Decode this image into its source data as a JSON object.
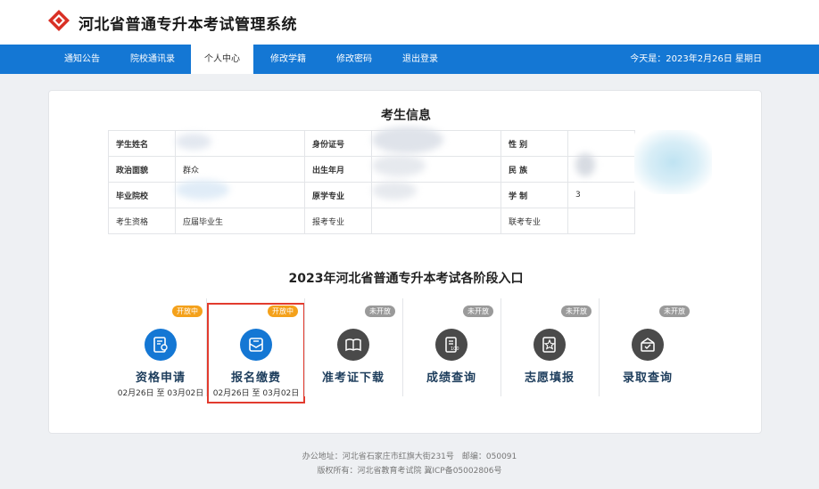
{
  "header": {
    "title": "河北省普通专升本考试管理系统",
    "logo_icon": "diamond-logo-icon"
  },
  "nav": {
    "items": [
      {
        "label": "通知公告"
      },
      {
        "label": "院校通讯录"
      },
      {
        "label": "个人中心",
        "active": true
      },
      {
        "label": "修改学籍"
      },
      {
        "label": "修改密码"
      },
      {
        "label": "退出登录"
      }
    ],
    "date": "今天是：2023年2月26日 星期日"
  },
  "student_info": {
    "title": "考生信息",
    "labels": {
      "name": "学生姓名",
      "id_card": "身份证号",
      "gender": "性 别",
      "politics": "政治面貌",
      "birth": "出生年月",
      "ethnicity": "民 族",
      "school": "毕业院校",
      "major": "原学专业",
      "schooling": "学 制",
      "qualification": "考生资格",
      "apply_major": "报考专业",
      "joint_major": "联考专业"
    },
    "values": {
      "politics": "群众",
      "schooling": "3",
      "qualification": "应届毕业生"
    }
  },
  "stages": {
    "title": "2023年河北省普通专升本考试各阶段入口",
    "items": [
      {
        "name": "资格申请",
        "badge": "开放中",
        "open": true,
        "dates": "02月26日 至 03月02日",
        "icon": "certificate-icon"
      },
      {
        "name": "报名缴费",
        "badge": "开放中",
        "open": true,
        "dates": "02月26日 至 03月02日",
        "icon": "envelope-icon",
        "highlighted": true
      },
      {
        "name": "准考证下载",
        "badge": "未开放",
        "open": false,
        "dates": "",
        "icon": "book-icon"
      },
      {
        "name": "成绩查询",
        "badge": "未开放",
        "open": false,
        "dates": "",
        "icon": "score-sheet-icon"
      },
      {
        "name": "志愿填报",
        "badge": "未开放",
        "open": false,
        "dates": "",
        "icon": "star-document-icon"
      },
      {
        "name": "录取查询",
        "badge": "未开放",
        "open": false,
        "dates": "",
        "icon": "mail-check-icon"
      }
    ]
  },
  "footer": {
    "address": "办公地址：河北省石家庄市红旗大街231号　邮编：050091",
    "copyright": "版权所有：河北省教育考试院 冀ICP备05002806号"
  },
  "colors": {
    "primary": "#1477d4",
    "open_badge": "#f4a11b",
    "closed_badge": "#9a9a9a",
    "highlight": "#e23b2e"
  }
}
